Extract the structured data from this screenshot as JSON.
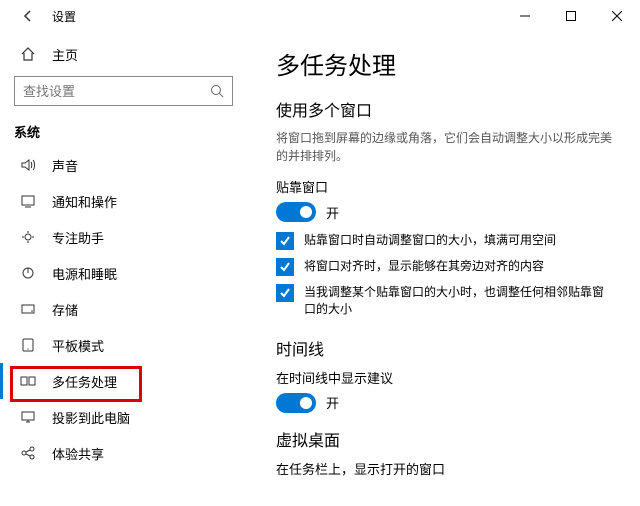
{
  "titlebar": {
    "title": "设置"
  },
  "sidebar": {
    "home": "主页",
    "search_placeholder": "查找设置",
    "section": "系统",
    "items": [
      {
        "label": "声音"
      },
      {
        "label": "通知和操作"
      },
      {
        "label": "专注助手"
      },
      {
        "label": "电源和睡眠"
      },
      {
        "label": "存储"
      },
      {
        "label": "平板模式"
      },
      {
        "label": "多任务处理"
      },
      {
        "label": "投影到此电脑"
      },
      {
        "label": "体验共享"
      }
    ]
  },
  "content": {
    "title": "多任务处理",
    "section1": {
      "heading": "使用多个窗口",
      "desc": "将窗口拖到屏幕的边缘或角落，它们会自动调整大小以形成完美的并排排列。",
      "toggle_label": "贴靠窗口",
      "toggle_state": "开",
      "checks": [
        "贴靠窗口时自动调整窗口的大小，填满可用空间",
        "将窗口对齐时，显示能够在其旁边对齐的内容",
        "当我调整某个贴靠窗口的大小时，也调整任何相邻贴靠窗口的大小"
      ]
    },
    "section2": {
      "heading": "时间线",
      "toggle_label": "在时间线中显示建议",
      "toggle_state": "开"
    },
    "section3": {
      "heading": "虚拟桌面",
      "label": "在任务栏上，显示打开的窗口"
    }
  }
}
